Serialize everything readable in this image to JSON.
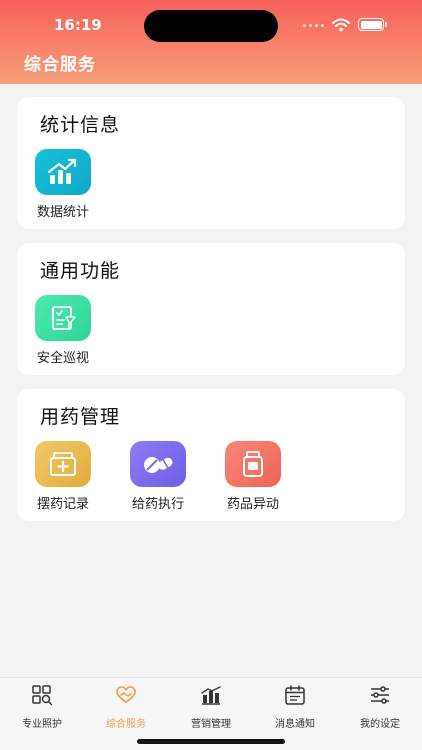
{
  "status_bar": {
    "time": "16:19"
  },
  "header": {
    "title": "综合服务"
  },
  "sections": [
    {
      "title": "统计信息",
      "items": [
        {
          "label": "数据统计",
          "icon": "chart-icon",
          "color": "#18b7d4"
        }
      ]
    },
    {
      "title": "通用功能",
      "items": [
        {
          "label": "安全巡视",
          "icon": "checklist-icon",
          "color": "#3ee3a4"
        }
      ]
    },
    {
      "title": "用药管理",
      "items": [
        {
          "label": "摆药记录",
          "icon": "medicine-box-icon",
          "color": "#e8b94c"
        },
        {
          "label": "给药执行",
          "icon": "pill-icon",
          "color": "#8070ec"
        },
        {
          "label": "药品异动",
          "icon": "medicine-bottle-icon",
          "color": "#f47366"
        }
      ]
    }
  ],
  "tabbar": {
    "active_color": "#f39a4e",
    "items": [
      {
        "label": "专业照护",
        "icon": "grid-search-icon"
      },
      {
        "label": "综合服务",
        "icon": "heart-hands-icon",
        "active": true
      },
      {
        "label": "营销管理",
        "icon": "bar-chart-icon"
      },
      {
        "label": "消息通知",
        "icon": "calendar-icon"
      },
      {
        "label": "我的设定",
        "icon": "sliders-icon"
      }
    ]
  }
}
